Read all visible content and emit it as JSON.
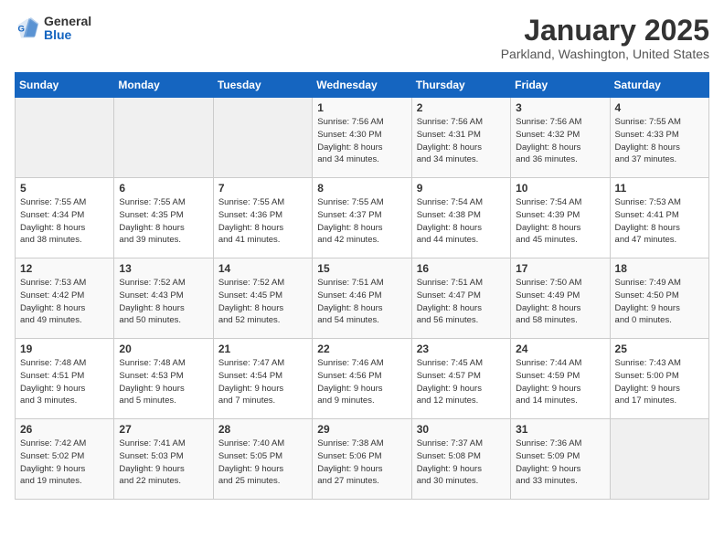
{
  "header": {
    "logo_line1": "General",
    "logo_line2": "Blue",
    "title": "January 2025",
    "subtitle": "Parkland, Washington, United States"
  },
  "days_of_week": [
    "Sunday",
    "Monday",
    "Tuesday",
    "Wednesday",
    "Thursday",
    "Friday",
    "Saturday"
  ],
  "weeks": [
    [
      {
        "day": null,
        "info": null
      },
      {
        "day": null,
        "info": null
      },
      {
        "day": null,
        "info": null
      },
      {
        "day": "1",
        "info": "Sunrise: 7:56 AM\nSunset: 4:30 PM\nDaylight: 8 hours\nand 34 minutes."
      },
      {
        "day": "2",
        "info": "Sunrise: 7:56 AM\nSunset: 4:31 PM\nDaylight: 8 hours\nand 34 minutes."
      },
      {
        "day": "3",
        "info": "Sunrise: 7:56 AM\nSunset: 4:32 PM\nDaylight: 8 hours\nand 36 minutes."
      },
      {
        "day": "4",
        "info": "Sunrise: 7:55 AM\nSunset: 4:33 PM\nDaylight: 8 hours\nand 37 minutes."
      }
    ],
    [
      {
        "day": "5",
        "info": "Sunrise: 7:55 AM\nSunset: 4:34 PM\nDaylight: 8 hours\nand 38 minutes."
      },
      {
        "day": "6",
        "info": "Sunrise: 7:55 AM\nSunset: 4:35 PM\nDaylight: 8 hours\nand 39 minutes."
      },
      {
        "day": "7",
        "info": "Sunrise: 7:55 AM\nSunset: 4:36 PM\nDaylight: 8 hours\nand 41 minutes."
      },
      {
        "day": "8",
        "info": "Sunrise: 7:55 AM\nSunset: 4:37 PM\nDaylight: 8 hours\nand 42 minutes."
      },
      {
        "day": "9",
        "info": "Sunrise: 7:54 AM\nSunset: 4:38 PM\nDaylight: 8 hours\nand 44 minutes."
      },
      {
        "day": "10",
        "info": "Sunrise: 7:54 AM\nSunset: 4:39 PM\nDaylight: 8 hours\nand 45 minutes."
      },
      {
        "day": "11",
        "info": "Sunrise: 7:53 AM\nSunset: 4:41 PM\nDaylight: 8 hours\nand 47 minutes."
      }
    ],
    [
      {
        "day": "12",
        "info": "Sunrise: 7:53 AM\nSunset: 4:42 PM\nDaylight: 8 hours\nand 49 minutes."
      },
      {
        "day": "13",
        "info": "Sunrise: 7:52 AM\nSunset: 4:43 PM\nDaylight: 8 hours\nand 50 minutes."
      },
      {
        "day": "14",
        "info": "Sunrise: 7:52 AM\nSunset: 4:45 PM\nDaylight: 8 hours\nand 52 minutes."
      },
      {
        "day": "15",
        "info": "Sunrise: 7:51 AM\nSunset: 4:46 PM\nDaylight: 8 hours\nand 54 minutes."
      },
      {
        "day": "16",
        "info": "Sunrise: 7:51 AM\nSunset: 4:47 PM\nDaylight: 8 hours\nand 56 minutes."
      },
      {
        "day": "17",
        "info": "Sunrise: 7:50 AM\nSunset: 4:49 PM\nDaylight: 8 hours\nand 58 minutes."
      },
      {
        "day": "18",
        "info": "Sunrise: 7:49 AM\nSunset: 4:50 PM\nDaylight: 9 hours\nand 0 minutes."
      }
    ],
    [
      {
        "day": "19",
        "info": "Sunrise: 7:48 AM\nSunset: 4:51 PM\nDaylight: 9 hours\nand 3 minutes."
      },
      {
        "day": "20",
        "info": "Sunrise: 7:48 AM\nSunset: 4:53 PM\nDaylight: 9 hours\nand 5 minutes."
      },
      {
        "day": "21",
        "info": "Sunrise: 7:47 AM\nSunset: 4:54 PM\nDaylight: 9 hours\nand 7 minutes."
      },
      {
        "day": "22",
        "info": "Sunrise: 7:46 AM\nSunset: 4:56 PM\nDaylight: 9 hours\nand 9 minutes."
      },
      {
        "day": "23",
        "info": "Sunrise: 7:45 AM\nSunset: 4:57 PM\nDaylight: 9 hours\nand 12 minutes."
      },
      {
        "day": "24",
        "info": "Sunrise: 7:44 AM\nSunset: 4:59 PM\nDaylight: 9 hours\nand 14 minutes."
      },
      {
        "day": "25",
        "info": "Sunrise: 7:43 AM\nSunset: 5:00 PM\nDaylight: 9 hours\nand 17 minutes."
      }
    ],
    [
      {
        "day": "26",
        "info": "Sunrise: 7:42 AM\nSunset: 5:02 PM\nDaylight: 9 hours\nand 19 minutes."
      },
      {
        "day": "27",
        "info": "Sunrise: 7:41 AM\nSunset: 5:03 PM\nDaylight: 9 hours\nand 22 minutes."
      },
      {
        "day": "28",
        "info": "Sunrise: 7:40 AM\nSunset: 5:05 PM\nDaylight: 9 hours\nand 25 minutes."
      },
      {
        "day": "29",
        "info": "Sunrise: 7:38 AM\nSunset: 5:06 PM\nDaylight: 9 hours\nand 27 minutes."
      },
      {
        "day": "30",
        "info": "Sunrise: 7:37 AM\nSunset: 5:08 PM\nDaylight: 9 hours\nand 30 minutes."
      },
      {
        "day": "31",
        "info": "Sunrise: 7:36 AM\nSunset: 5:09 PM\nDaylight: 9 hours\nand 33 minutes."
      },
      {
        "day": null,
        "info": null
      }
    ]
  ]
}
